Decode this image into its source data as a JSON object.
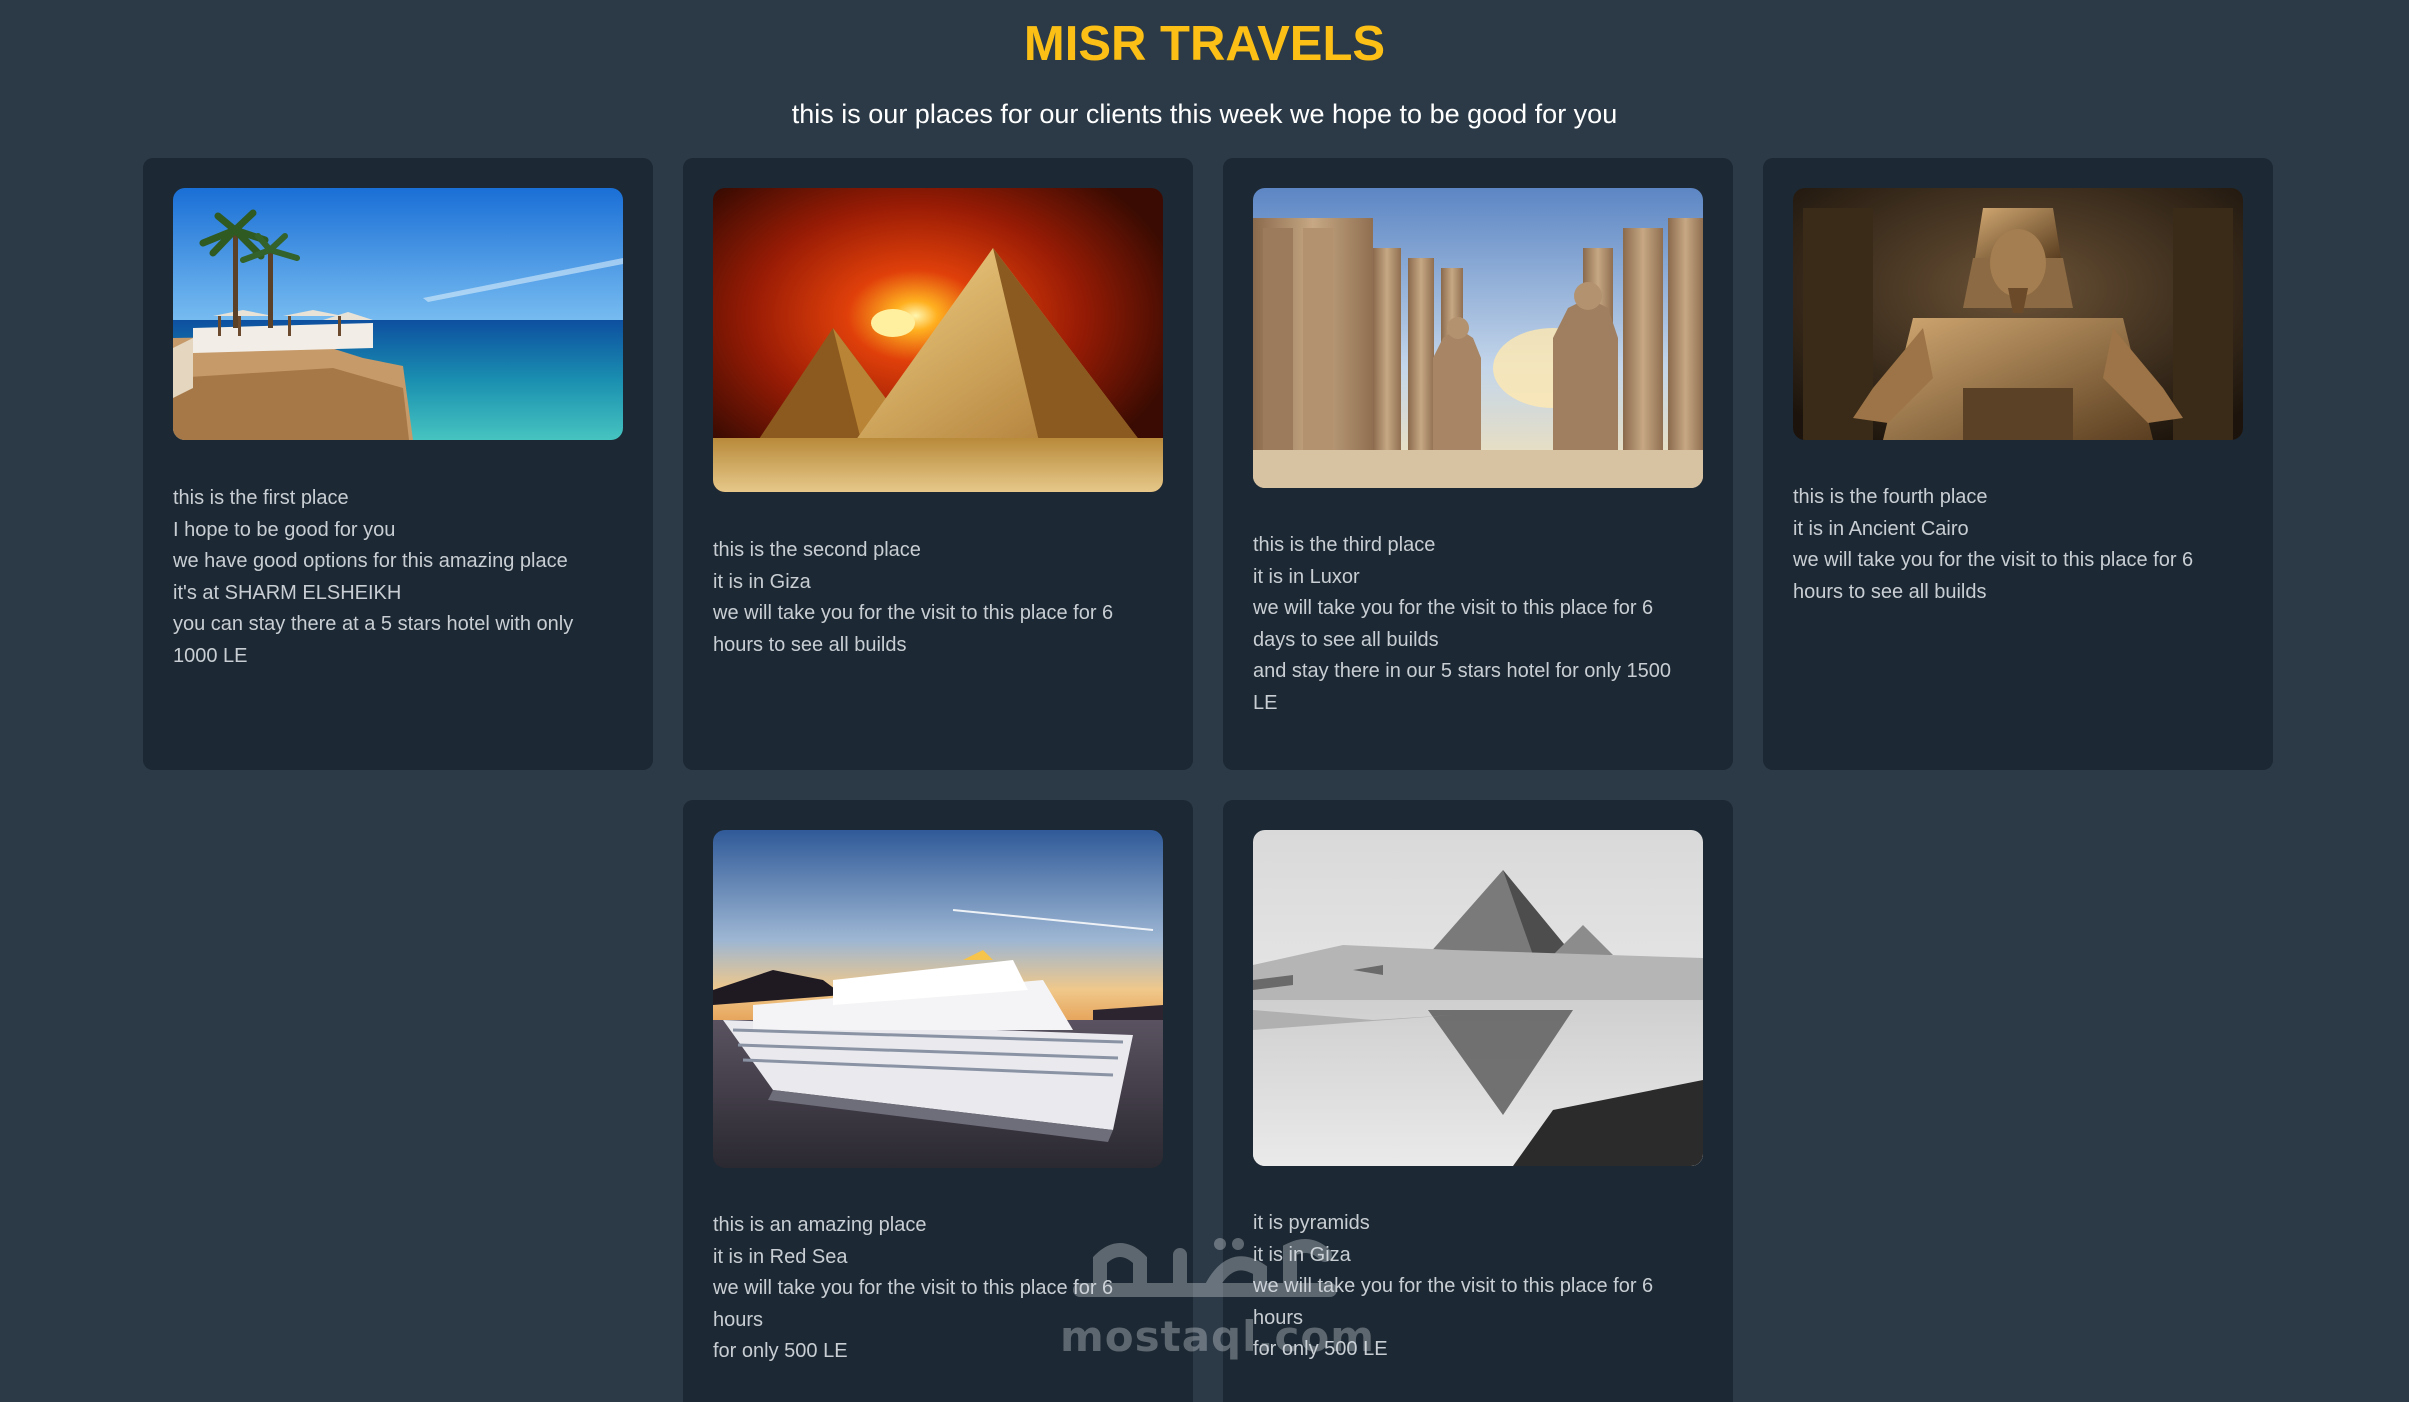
{
  "header": {
    "title": "MISR TRAVELS",
    "tagline": "this is our places for our clients this week we hope to be good for you"
  },
  "cards": [
    {
      "image": "beach resort in Sharm El Sheikh",
      "lines": [
        "this is the first place",
        "I hope to be good for you",
        "we have good options for this amazing place",
        "it's at SHARM ELSHEIKH",
        "you can stay there at a 5 stars hotel with only",
        "1000 LE"
      ]
    },
    {
      "image": "pyramids at sunset",
      "lines": [
        "this is the second place",
        "it is in Giza",
        "we will take you for the visit to this place for 6",
        "hours to see all builds"
      ]
    },
    {
      "image": "Luxor temple columns and statues",
      "lines": [
        "this is the third place",
        "it is in Luxor",
        "we will take you for the visit to this place for 6",
        "days to see all builds",
        "and stay there in our 5 stars hotel for only 1500",
        "LE"
      ]
    },
    {
      "image": "pharaoh statue",
      "lines": [
        "this is the fourth place",
        "it is in Ancient Cairo",
        "we will take you for the visit to this place for 6",
        "hours to see all builds"
      ]
    },
    {
      "image": "cruise ship at sunset",
      "lines": [
        "this is an amazing place",
        "it is in Red Sea",
        "we will take you for the visit to this place for 6",
        "hours",
        "for only 500 LE"
      ]
    },
    {
      "image": "black and white pyramid reflection",
      "lines": [
        "it is pyramids",
        "it is in Giza",
        "we will take you for the visit to this place for 6",
        "hours",
        "for only 500 LE"
      ]
    }
  ],
  "watermark": {
    "arabic": "مستقل",
    "latin": "mostaql.com"
  },
  "colors": {
    "background": "#2c3a47",
    "card": "#1c2833",
    "title": "#fcbf16",
    "text": "#c8ced3"
  }
}
